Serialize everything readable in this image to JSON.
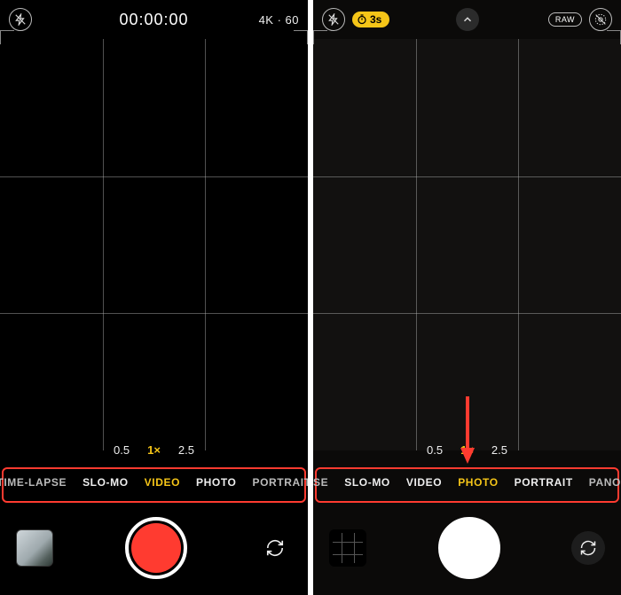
{
  "left": {
    "timer": "00:00:00",
    "resolution": "4K · 60",
    "zoom_levels": [
      "0.5",
      "1×",
      "2.5"
    ],
    "zoom_selected_index": 1,
    "modes": [
      "TIME-LAPSE",
      "SLO-MO",
      "VIDEO",
      "PHOTO",
      "PORTRAIT"
    ],
    "mode_selected_index": 2,
    "shutter_style": "video"
  },
  "right": {
    "timer_badge": "3s",
    "raw_label": "RAW",
    "zoom_levels": [
      "0.5",
      "1×",
      "2.5"
    ],
    "zoom_selected_index": 1,
    "modes_prefix": "SE",
    "modes": [
      "SLO-MO",
      "VIDEO",
      "PHOTO",
      "PORTRAIT",
      "PANO"
    ],
    "mode_selected_index": 2,
    "shutter_style": "photo"
  }
}
